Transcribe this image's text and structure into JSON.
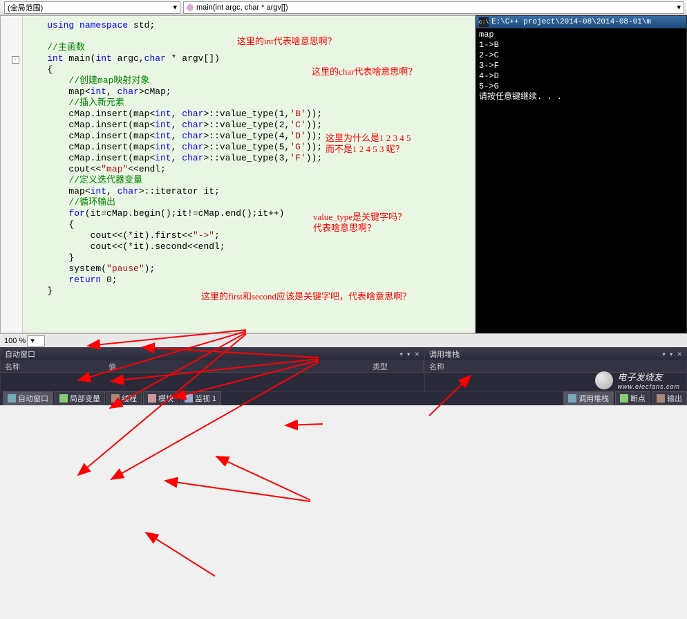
{
  "topbar": {
    "scope": "(全局范围)",
    "function": "main(int argc, char * argv[])"
  },
  "code": {
    "lines": [
      {
        "indent": 1,
        "spans": [
          {
            "cls": "kw",
            "t": "using namespace"
          },
          {
            "t": " std;"
          }
        ]
      },
      {
        "indent": 1,
        "spans": []
      },
      {
        "indent": 1,
        "spans": [
          {
            "cls": "comment",
            "t": "//主函数"
          }
        ]
      },
      {
        "indent": 1,
        "spans": [
          {
            "cls": "kw",
            "t": "int"
          },
          {
            "t": " main("
          },
          {
            "cls": "kw",
            "t": "int"
          },
          {
            "t": " argc,"
          },
          {
            "cls": "kw",
            "t": "char"
          },
          {
            "t": " * argv[])"
          }
        ]
      },
      {
        "indent": 1,
        "spans": [
          {
            "t": "{"
          }
        ]
      },
      {
        "indent": 2,
        "spans": [
          {
            "cls": "comment",
            "t": "//创建map映射对象"
          }
        ]
      },
      {
        "indent": 2,
        "spans": [
          {
            "t": "map<"
          },
          {
            "cls": "kw",
            "t": "int"
          },
          {
            "t": ", "
          },
          {
            "cls": "kw",
            "t": "char"
          },
          {
            "t": ">cMap;"
          }
        ]
      },
      {
        "indent": 2,
        "spans": [
          {
            "cls": "comment",
            "t": "//插入新元素"
          }
        ]
      },
      {
        "indent": 2,
        "spans": [
          {
            "t": "cMap.insert(map<"
          },
          {
            "cls": "kw",
            "t": "int"
          },
          {
            "t": ", "
          },
          {
            "cls": "kw",
            "t": "char"
          },
          {
            "t": ">::value_type(1,"
          },
          {
            "cls": "str",
            "t": "'B'"
          },
          {
            "t": "));"
          }
        ]
      },
      {
        "indent": 2,
        "spans": [
          {
            "t": "cMap.insert(map<"
          },
          {
            "cls": "kw",
            "t": "int"
          },
          {
            "t": ", "
          },
          {
            "cls": "kw",
            "t": "char"
          },
          {
            "t": ">::value_type(2,"
          },
          {
            "cls": "str",
            "t": "'C'"
          },
          {
            "t": "));"
          }
        ]
      },
      {
        "indent": 2,
        "spans": [
          {
            "t": "cMap.insert(map<"
          },
          {
            "cls": "kw",
            "t": "int"
          },
          {
            "t": ", "
          },
          {
            "cls": "kw",
            "t": "char"
          },
          {
            "t": ">::value_type(4,"
          },
          {
            "cls": "str",
            "t": "'D'"
          },
          {
            "t": "));"
          }
        ]
      },
      {
        "indent": 2,
        "spans": [
          {
            "t": "cMap.insert(map<"
          },
          {
            "cls": "kw",
            "t": "int"
          },
          {
            "t": ", "
          },
          {
            "cls": "kw",
            "t": "char"
          },
          {
            "t": ">::value_type(5,"
          },
          {
            "cls": "str",
            "t": "'G'"
          },
          {
            "t": "));"
          }
        ]
      },
      {
        "indent": 2,
        "spans": [
          {
            "t": "cMap.insert(map<"
          },
          {
            "cls": "kw",
            "t": "int"
          },
          {
            "t": ", "
          },
          {
            "cls": "kw",
            "t": "char"
          },
          {
            "t": ">::value_type(3,"
          },
          {
            "cls": "str",
            "t": "'F'"
          },
          {
            "t": "));"
          }
        ]
      },
      {
        "indent": 2,
        "spans": [
          {
            "t": "cout<<"
          },
          {
            "cls": "str",
            "t": "\"map\""
          },
          {
            "t": "<<endl;"
          }
        ]
      },
      {
        "indent": 2,
        "spans": [
          {
            "cls": "comment",
            "t": "//定义迭代器变量"
          }
        ]
      },
      {
        "indent": 2,
        "spans": [
          {
            "t": "map<"
          },
          {
            "cls": "kw",
            "t": "int"
          },
          {
            "t": ", "
          },
          {
            "cls": "kw",
            "t": "char"
          },
          {
            "t": ">::iterator it;"
          }
        ]
      },
      {
        "indent": 2,
        "spans": [
          {
            "cls": "comment",
            "t": "//循环输出"
          }
        ]
      },
      {
        "indent": 2,
        "spans": [
          {
            "cls": "kw",
            "t": "for"
          },
          {
            "t": "(it=cMap.begin();it!=cMap.end();it++)"
          }
        ]
      },
      {
        "indent": 2,
        "spans": [
          {
            "t": "{"
          }
        ]
      },
      {
        "indent": 3,
        "spans": [
          {
            "t": "cout<<(*it).first<<"
          },
          {
            "cls": "str",
            "t": "\"->\""
          },
          {
            "t": ";"
          }
        ]
      },
      {
        "indent": 3,
        "spans": [
          {
            "t": "cout<<(*it).second<<endl;"
          }
        ]
      },
      {
        "indent": 2,
        "spans": [
          {
            "t": "}"
          }
        ]
      },
      {
        "indent": 2,
        "spans": [
          {
            "t": "system("
          },
          {
            "cls": "str",
            "t": "\"pause\""
          },
          {
            "t": ");"
          }
        ]
      },
      {
        "indent": 2,
        "spans": [
          {
            "cls": "kw",
            "t": "return"
          },
          {
            "t": " 0;"
          }
        ]
      },
      {
        "indent": 1,
        "spans": [
          {
            "t": "}"
          }
        ]
      }
    ]
  },
  "annotations": {
    "a1": "这里的int代表啥意思啊？",
    "a2": "这里的char代表啥意思啊？",
    "a3_line1": "这里为什么是1 2 3 4 5",
    "a3_line2": "而不是1 2 4 5 3 呢？",
    "a4_line1": "value_type是关键字吗？",
    "a4_line2": "代表啥意思啊？",
    "a5": "这里的first和second应该是关键字吧，代表啥意思啊？"
  },
  "console": {
    "title": "E:\\C++ project\\2014-08\\2014-08-01\\m",
    "lines": [
      "map",
      "1->B",
      "2->C",
      "3->F",
      "4->D",
      "5->G",
      "请按任意键继续. . ."
    ]
  },
  "zoom": {
    "value": "100 %"
  },
  "panels": {
    "auto": {
      "title": "自动窗口",
      "cols": [
        "名称",
        "值",
        "类型"
      ]
    },
    "callstack": {
      "title": "调用堆栈",
      "cols": [
        "名称"
      ]
    }
  },
  "tabs": {
    "left": [
      "自动窗口",
      "局部变量",
      "线程",
      "模块",
      "监视 1"
    ],
    "right": [
      "调用堆栈",
      "断点",
      "输出"
    ]
  },
  "watermark": {
    "main": "电子发烧友",
    "sub": "www.elecfans.com"
  }
}
